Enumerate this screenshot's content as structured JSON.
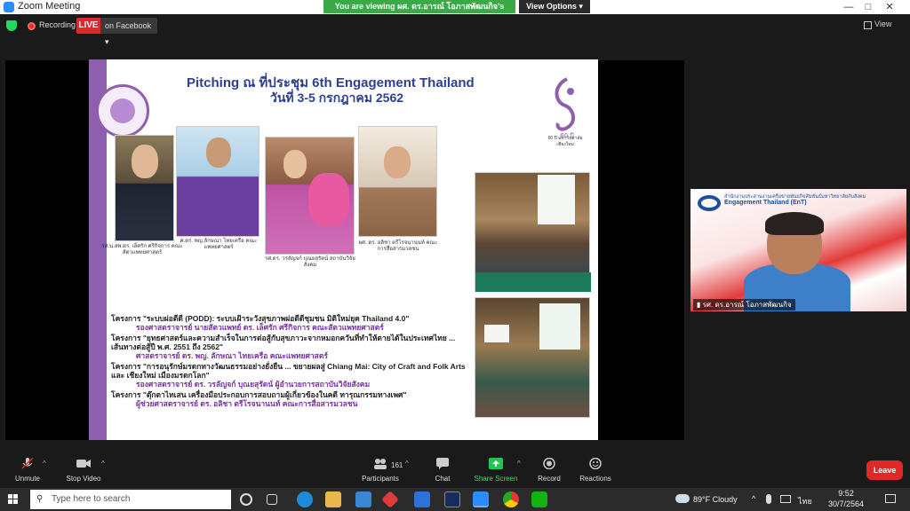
{
  "window": {
    "title": "Zoom Meeting",
    "view_label": "View"
  },
  "banner": {
    "viewing_text": "You are viewing ผศ. ดร.อารณ์ โอภาสพัฒนกิจ's screen",
    "view_options_label": "View Options"
  },
  "topbar": {
    "recording_label": "Recording",
    "live_label": "LIVE",
    "live_target": "on Facebook"
  },
  "slide": {
    "title_line1": "Pitching ณ ที่ประชุม 6th Engagement Thailand",
    "title_line2": "วันที่ 3-5 กรกฎาคม 2562",
    "logo_caption": "60 ปี มหาวิทยาลัยเชียงใหม่",
    "people": [
      {
        "caption": "รศ.น.สพ.ดร. เล็ศรัก ศรีกิจการ คณะสัตวแพทยศาสตร์"
      },
      {
        "caption": "ศ.ดร. พญ.ลักษณา ไทยเครือ คณะแพทยศาสตร์"
      },
      {
        "caption": "รศ.ดร. วรลัญจก์ บุณยสุรัตน์ สถาบันวิจัยสังคม"
      },
      {
        "caption": "ผศ. ดร. อลิชา ตรีโรจนานนท์ คณะการสื่อสารมวลชน"
      }
    ],
    "projects": [
      {
        "text": "โครงการ \"ระบบผ่อดีดี (PODD): ระบบเฝ้าระวังสุขภาพผ่อดีดีชุมชน มิติใหม่ยุค Thailand 4.0\"",
        "lead": "รองศาสตราจารย์ นายสัตวแพทย์ ดร. เล็ศรัก ศรีกิจการ คณะสัตวแพทยศาสตร์"
      },
      {
        "text": "โครงการ \"ยุทธศาสตร์และความสำเร็จในการต่อสู้กับสุขภาวะจากหมอกควันที่ทำให้ตายได้ในประเทศไทย ... เส้นทางต่อสู้ปี พ.ศ. 2551 ถึง 2562\"",
        "lead": "ศาสตราจารย์ ดร. พญ. ลักษณา ไทยเครือ คณะแพทยศาสตร์"
      },
      {
        "text": "โครงการ \"การอนุรักษ์มรดกทางวัฒนธรรมอย่างยั่งยืน ... ขยายผลสู่ Chiang Mai: City of Craft and Folk Arts และ เชียงใหม่ เมืองมรดกโลก\"",
        "lead": "รองศาสตราจารย์ ดร. วรลัญจก์ บุณยสุรัตน์ ผู้อำนวยการสถาบันวิจัยสังคม"
      },
      {
        "text": "โครงการ \"ตุ๊กตาไทเสน เครื่องมือประกอบการสอบถามผู้เกี่ยวข้องในคดี ทารุณกรรมทางเพศ\"",
        "lead": "ผู้ช่วยศาสตราจารย์ ดร. อลิชา ตรีโรจนานนท์ คณะการสื่อสารมวลชน"
      }
    ]
  },
  "tile": {
    "org_line1": "สำนักงานประสานงานเครือข่ายพันธกิจสัมพันธ์มหาวิทยาลัยกับสังคม",
    "org_line2": "Engagement Thailand (EnT)",
    "name": "รศ. ดร.อารณ์ โอภาสพัฒนกิจ"
  },
  "controls": {
    "unmute": "Unmute",
    "stop_video": "Stop Video",
    "participants": "Participants",
    "participants_count": "161",
    "chat": "Chat",
    "share_screen": "Share Screen",
    "record": "Record",
    "reactions": "Reactions",
    "leave": "Leave"
  },
  "taskbar": {
    "search_placeholder": "Type here to search",
    "weather": "89°F Cloudy",
    "lang": "ไทย",
    "time": "9:52",
    "date": "30/7/2564"
  },
  "colors": {
    "accent_green": "#3aaa47",
    "live_red": "#e02828",
    "slide_purple": "#8e5fae",
    "slide_title_blue": "#2e3f8f"
  }
}
